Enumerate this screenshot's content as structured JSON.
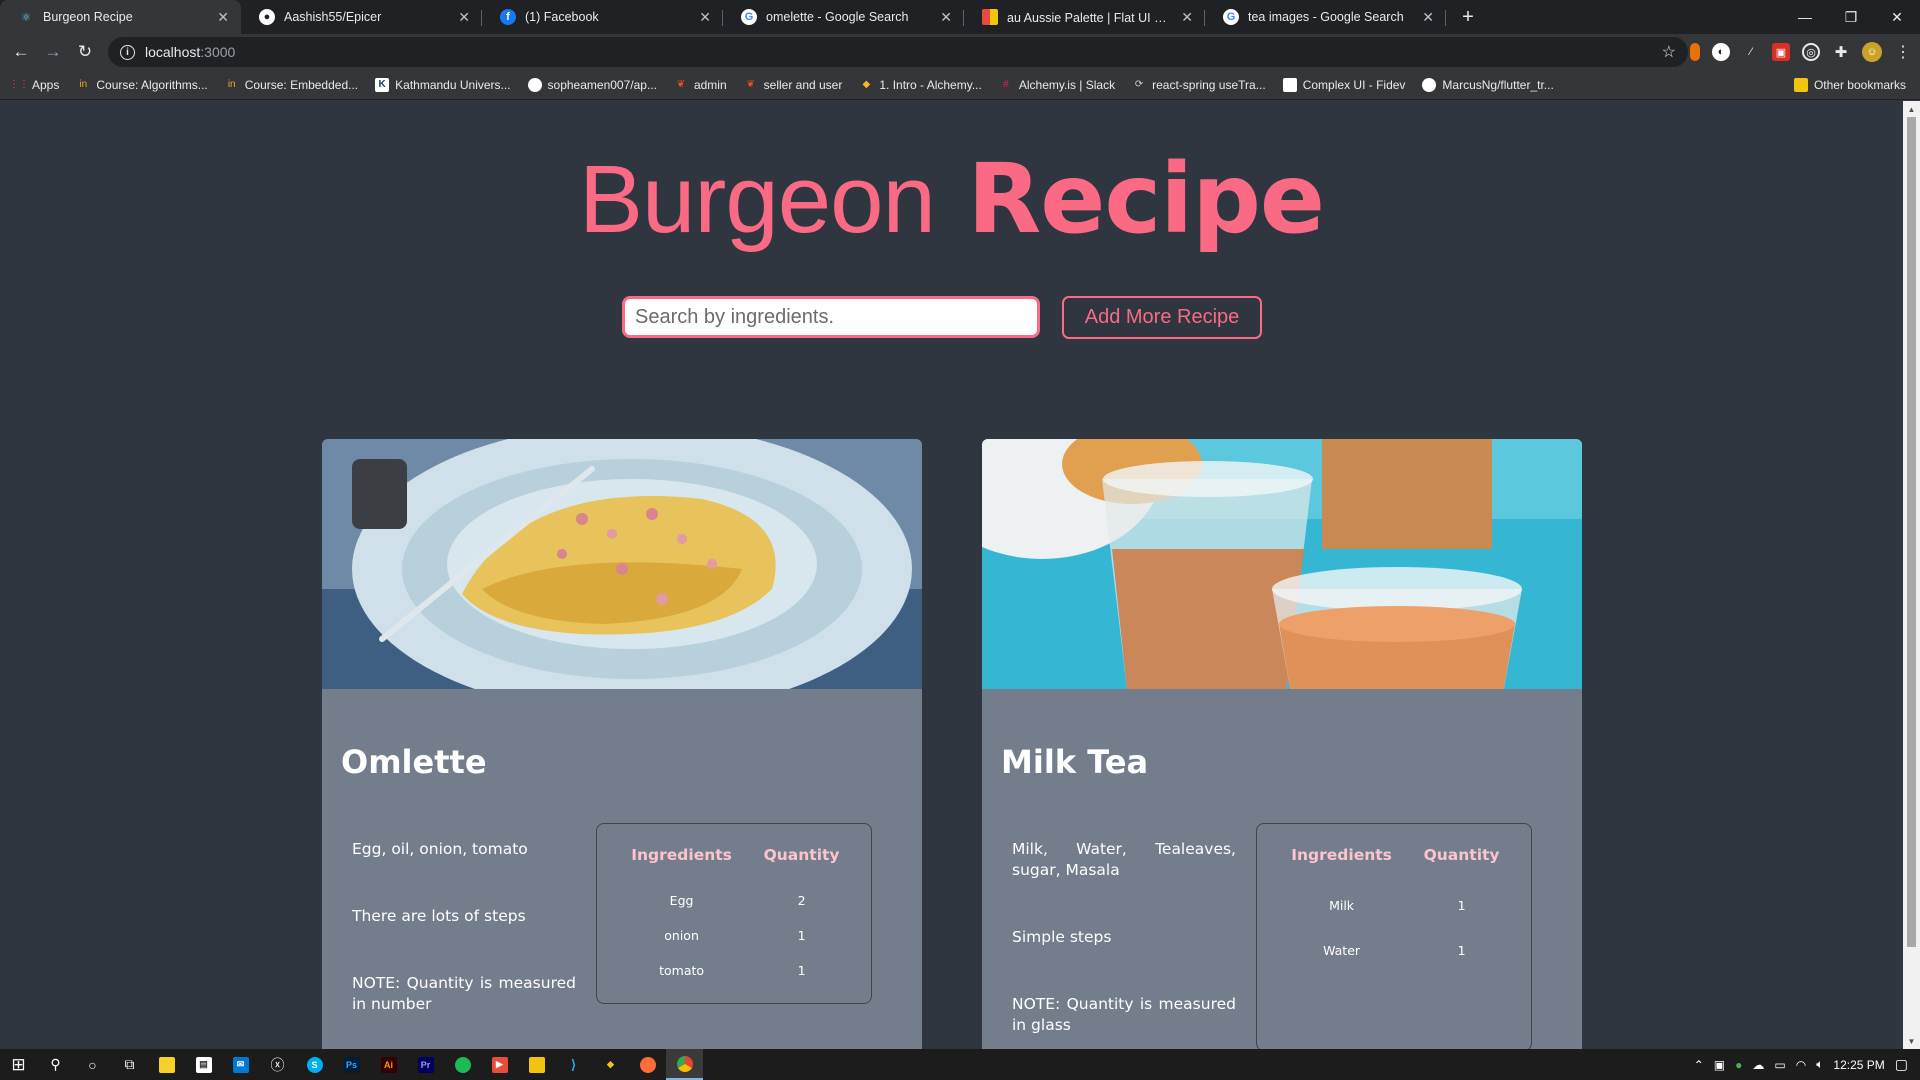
{
  "browser": {
    "tabs": [
      {
        "title": "Burgeon Recipe",
        "icon": "react-icon",
        "color": "#61dafb",
        "active": true
      },
      {
        "title": "Aashish55/Epicer",
        "icon": "github-icon",
        "color": "#ffffff"
      },
      {
        "title": "(1) Facebook",
        "icon": "facebook-icon",
        "color": "#1877f2"
      },
      {
        "title": "omelette - Google Search",
        "icon": "google-icon",
        "color": "#ffffff"
      },
      {
        "title": "au Aussie Palette | Flat UI Colors ❤",
        "icon": "flatui-icon",
        "color": "#e74c3c"
      },
      {
        "title": "tea images - Google Search",
        "icon": "google-icon",
        "color": "#ffffff"
      }
    ],
    "new_tab": "+",
    "url_host": "localhost",
    "url_port": ":3000",
    "bookmarks": [
      {
        "label": "Apps",
        "icon": "apps-grid-icon",
        "color": "#ea4335"
      },
      {
        "label": "Course: Algorithms...",
        "icon": "course-icon",
        "color": "#f5a623"
      },
      {
        "label": "Course: Embedded...",
        "icon": "course-icon",
        "color": "#f5a623"
      },
      {
        "label": "Kathmandu Univers...",
        "icon": "ku-icon",
        "color": "#ffffff"
      },
      {
        "label": "sopheamen007/ap...",
        "icon": "github-icon",
        "color": "#ffffff"
      },
      {
        "label": "admin",
        "icon": "figma-icon",
        "color": "#f24e1e"
      },
      {
        "label": "seller and user",
        "icon": "figma-icon",
        "color": "#f24e1e"
      },
      {
        "label": "1. Intro - Alchemy...",
        "icon": "alchemy-icon",
        "color": "#f7b731"
      },
      {
        "label": "Alchemy.is | Slack",
        "icon": "slack-icon",
        "color": "#e01e5a"
      },
      {
        "label": "react-spring useTra...",
        "icon": "spring-icon",
        "color": "#cccccc"
      },
      {
        "label": "Complex UI - Fidev",
        "icon": "page-icon",
        "color": "#ffffff"
      },
      {
        "label": "MarcusNg/flutter_tr...",
        "icon": "github-icon",
        "color": "#ffffff"
      }
    ],
    "other_bookmarks": "Other bookmarks"
  },
  "app": {
    "title_light": "Burgeon",
    "title_bold": "Recipe",
    "accent": "#fa6a85",
    "search_placeholder": "Search by ingredients.",
    "add_button": "Add More Recipe"
  },
  "recipes": [
    {
      "name": "Omlette",
      "image": "omelette-photo",
      "ingredients_text": "Egg, oil, onion, tomato",
      "steps": "There are lots of steps",
      "note": "NOTE: Quantity is measured in number",
      "table_headers": [
        "Ingredients",
        "Quantity"
      ],
      "rows": [
        [
          "Egg",
          "2"
        ],
        [
          "onion",
          "1"
        ],
        [
          "tomato",
          "1"
        ]
      ]
    },
    {
      "name": "Milk Tea",
      "image": "milk-tea-photo",
      "ingredients_text": "Milk, Water, Tealeaves, sugar, Masala",
      "steps": "Simple steps",
      "note": "NOTE: Quantity is measured in glass",
      "table_headers": [
        "Ingredients",
        "Quantity"
      ],
      "rows": [
        [
          "Milk",
          "1"
        ],
        [
          "Water",
          "1"
        ]
      ]
    }
  ],
  "taskbar": {
    "time": "12:25 PM"
  }
}
